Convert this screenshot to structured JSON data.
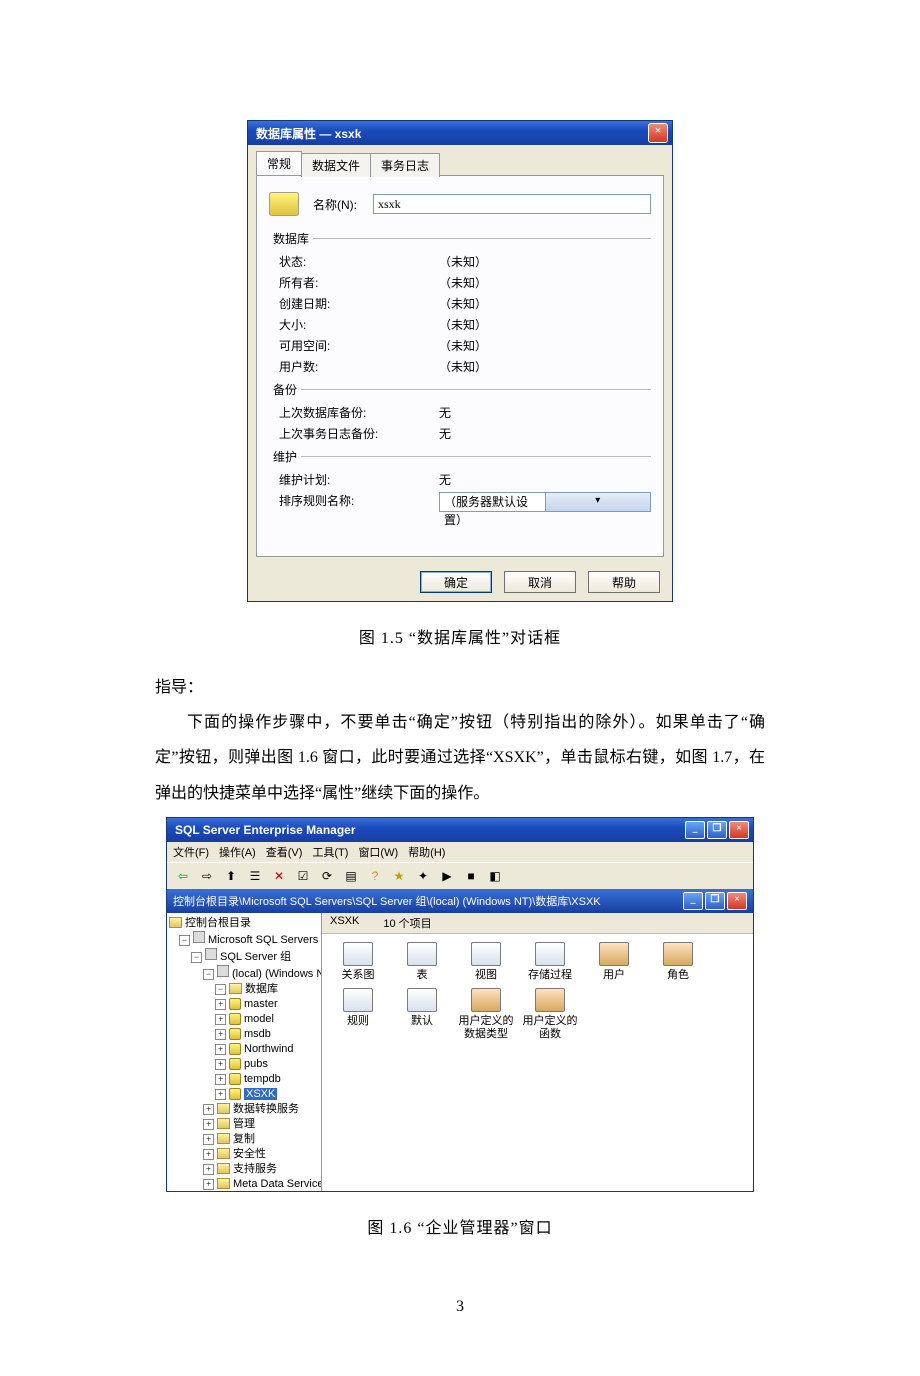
{
  "dialog1": {
    "title": "数据库属性 — xsxk",
    "tabs": {
      "general": "常规",
      "datafiles": "数据文件",
      "txlog": "事务日志"
    },
    "name_label": "名称(N):",
    "name_value": "xsxk",
    "group_db": "数据库",
    "rows_db": {
      "status_k": "状态:",
      "status_v": "（未知）",
      "owner_k": "所有者:",
      "owner_v": "（未知）",
      "created_k": "创建日期:",
      "created_v": "（未知）",
      "size_k": "大小:",
      "size_v": "（未知）",
      "space_k": "可用空间:",
      "space_v": "（未知）",
      "users_k": "用户数:",
      "users_v": "（未知）"
    },
    "group_backup": "备份",
    "rows_backup": {
      "lastdb_k": "上次数据库备份:",
      "lastdb_v": "无",
      "lastlog_k": "上次事务日志备份:",
      "lastlog_v": "无"
    },
    "group_maint": "维护",
    "rows_maint": {
      "plan_k": "维护计划:",
      "plan_v": "无",
      "coll_k": "排序规则名称:",
      "coll_v": "（服务器默认设置）"
    },
    "buttons": {
      "ok": "确定",
      "cancel": "取消",
      "help": "帮助"
    }
  },
  "caption1": "图 1.5  “数据库属性”对话框",
  "text": {
    "guide": "指导：",
    "p1": "下面的操作步骤中，不要单击“确定”按钮（特别指出的除外）。如果单击了“确定”按钮，则弹出图 1.6 窗口，此时要通过选择“XSXK”，单击鼠标右键，如图 1.7，在弹出的快捷菜单中选择“属性”继续下面的操作。"
  },
  "em": {
    "title": "SQL Server Enterprise Manager",
    "menu": {
      "file": "文件(F)",
      "action": "操作(A)",
      "view": "查看(V)",
      "tools": "工具(T)",
      "window": "窗口(W)",
      "help": "帮助(H)"
    },
    "path": "控制台根目录\\Microsoft SQL Servers\\SQL Server 组\\(local) (Windows NT)\\数据库\\XSXK",
    "list_title": "XSXK",
    "list_count": "10 个项目",
    "tree": {
      "root": "控制台根目录",
      "n1": "Microsoft SQL Servers",
      "n2": "SQL Server 组",
      "n3": "(local) (Windows NT)",
      "db": "数据库",
      "dbs": {
        "a": "master",
        "b": "model",
        "c": "msdb",
        "d": "Northwind",
        "e": "pubs",
        "f": "tempdb",
        "g": "XSXK"
      },
      "o1": "数据转换服务",
      "o2": "管理",
      "o3": "复制",
      "o4": "安全性",
      "o5": "支持服务",
      "o6": "Meta Data Services"
    },
    "icons": {
      "a": "关系图",
      "b": "表",
      "c": "视图",
      "d": "存储过程",
      "e": "用户",
      "f": "角色",
      "g": "规则",
      "h": "默认",
      "i": "用户定义的数据类型",
      "j": "用户定义的函数"
    }
  },
  "caption2": "图 1.6  “企业管理器”窗口",
  "pagenum": "3"
}
